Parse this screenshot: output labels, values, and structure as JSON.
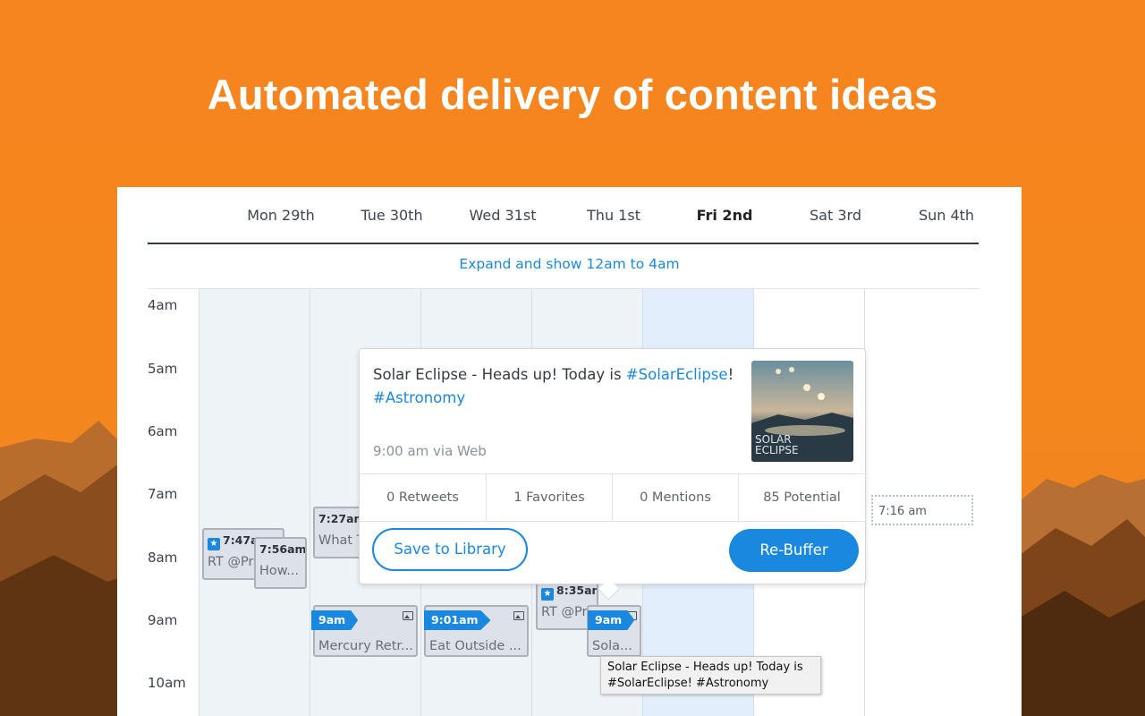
{
  "headline": "Automated delivery of content ideas",
  "calendar": {
    "days": [
      {
        "label": "Mon 29th"
      },
      {
        "label": "Tue 30th"
      },
      {
        "label": "Wed 31st"
      },
      {
        "label": "Thu 1st"
      },
      {
        "label": "Fri 2nd",
        "today": true
      },
      {
        "label": "Sat 3rd"
      },
      {
        "label": "Sun 4th"
      }
    ],
    "expand_link": "Expand and show 12am to 4am",
    "hours": [
      "4am",
      "5am",
      "6am",
      "7am",
      "8am",
      "9am",
      "10am"
    ],
    "events": {
      "mon_747": {
        "time": "7:47am",
        "body": "RT @Pr"
      },
      "mon_756": {
        "time": "7:56am",
        "body": "How..."
      },
      "tue_727": {
        "time": "7:27am",
        "body": "What T"
      },
      "tue_9am": {
        "time": "9am",
        "body": "Mercury Retr..."
      },
      "wed_901": {
        "time": "9:01am",
        "body": "Eat Outside ..."
      },
      "thu_835": {
        "time": "8:35am",
        "body": "RT @Pr"
      },
      "thu_9am": {
        "time": "9am",
        "body": "Sola..."
      },
      "sun_716": {
        "time": "7:16 am"
      }
    }
  },
  "popup": {
    "text_plain": "Solar Eclipse - Heads up! Today is ",
    "hashtag1": "#SolarEclipse",
    "text_after": "!",
    "hashtag2": "#Astronomy",
    "meta": "9:00 am via Web",
    "thumb_text": "SOLAR\nECLIPSE",
    "stats": {
      "retweets": "0 Retweets",
      "favorites": "1 Favorites",
      "mentions": "0 Mentions",
      "potential": "85 Potential"
    },
    "save_button": "Save to Library",
    "rebuffer_button": "Re-Buffer"
  },
  "tooltip": "Solar Eclipse - Heads up! Today is #SolarEclipse! #Astronomy",
  "colors": {
    "accent": "#1b88e0",
    "background": "#f6841f"
  }
}
